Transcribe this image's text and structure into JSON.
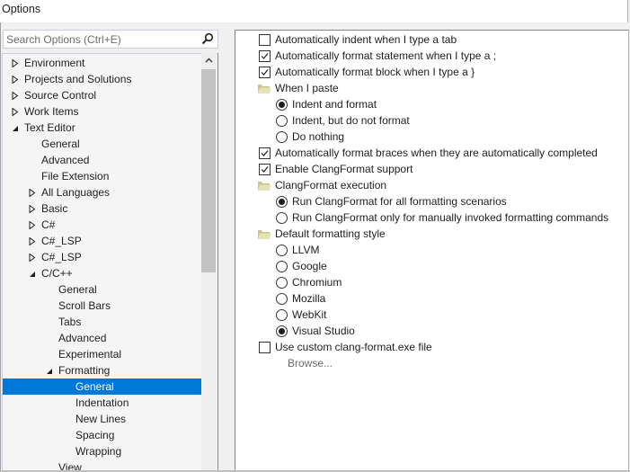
{
  "window": {
    "title": "Options"
  },
  "search": {
    "placeholder": "Search Options (Ctrl+E)",
    "value": ""
  },
  "tree": {
    "items": [
      {
        "label": "Environment",
        "level": 0,
        "expander": "collapsed"
      },
      {
        "label": "Projects and Solutions",
        "level": 0,
        "expander": "collapsed"
      },
      {
        "label": "Source Control",
        "level": 0,
        "expander": "collapsed"
      },
      {
        "label": "Work Items",
        "level": 0,
        "expander": "collapsed"
      },
      {
        "label": "Text Editor",
        "level": 0,
        "expander": "expanded"
      },
      {
        "label": "General",
        "level": 1,
        "expander": "none"
      },
      {
        "label": "Advanced",
        "level": 1,
        "expander": "none"
      },
      {
        "label": "File Extension",
        "level": 1,
        "expander": "none"
      },
      {
        "label": "All Languages",
        "level": 1,
        "expander": "collapsed"
      },
      {
        "label": "Basic",
        "level": 1,
        "expander": "collapsed"
      },
      {
        "label": "C#",
        "level": 1,
        "expander": "collapsed"
      },
      {
        "label": "C#_LSP",
        "level": 1,
        "expander": "collapsed"
      },
      {
        "label": "C#_LSP",
        "level": 1,
        "expander": "collapsed"
      },
      {
        "label": "C/C++",
        "level": 1,
        "expander": "expanded"
      },
      {
        "label": "General",
        "level": 2,
        "expander": "none"
      },
      {
        "label": "Scroll Bars",
        "level": 2,
        "expander": "none"
      },
      {
        "label": "Tabs",
        "level": 2,
        "expander": "none"
      },
      {
        "label": "Advanced",
        "level": 2,
        "expander": "none"
      },
      {
        "label": "Experimental",
        "level": 2,
        "expander": "none"
      },
      {
        "label": "Formatting",
        "level": 2,
        "expander": "expanded"
      },
      {
        "label": "General",
        "level": 3,
        "expander": "none",
        "selected": true
      },
      {
        "label": "Indentation",
        "level": 3,
        "expander": "none"
      },
      {
        "label": "New Lines",
        "level": 3,
        "expander": "none"
      },
      {
        "label": "Spacing",
        "level": 3,
        "expander": "none"
      },
      {
        "label": "Wrapping",
        "level": 3,
        "expander": "none"
      },
      {
        "label": "View",
        "level": 2,
        "expander": "none"
      }
    ]
  },
  "options": [
    {
      "type": "checkbox",
      "label": "Automatically indent when I type a tab",
      "checked": false,
      "indent": 0
    },
    {
      "type": "checkbox",
      "label": "Automatically format statement when I type a ;",
      "checked": true,
      "indent": 0
    },
    {
      "type": "checkbox",
      "label": "Automatically format block when I type a }",
      "checked": true,
      "indent": 0
    },
    {
      "type": "group",
      "label": "When I paste",
      "indent": 0
    },
    {
      "type": "radio",
      "label": "Indent and format",
      "checked": true,
      "indent": 1
    },
    {
      "type": "radio",
      "label": "Indent, but do not format",
      "checked": false,
      "indent": 1
    },
    {
      "type": "radio",
      "label": "Do nothing",
      "checked": false,
      "indent": 1
    },
    {
      "type": "checkbox",
      "label": "Automatically format braces when they are automatically completed",
      "checked": true,
      "indent": 0
    },
    {
      "type": "checkbox",
      "label": "Enable ClangFormat support",
      "checked": true,
      "indent": 0
    },
    {
      "type": "group",
      "label": "ClangFormat execution",
      "indent": 0
    },
    {
      "type": "radio",
      "label": "Run ClangFormat for all formatting scenarios",
      "checked": true,
      "indent": 1
    },
    {
      "type": "radio",
      "label": "Run ClangFormat only for manually invoked formatting commands",
      "checked": false,
      "indent": 1
    },
    {
      "type": "group",
      "label": "Default formatting style",
      "indent": 0
    },
    {
      "type": "radio",
      "label": "LLVM",
      "checked": false,
      "indent": 1
    },
    {
      "type": "radio",
      "label": "Google",
      "checked": false,
      "indent": 1
    },
    {
      "type": "radio",
      "label": "Chromium",
      "checked": false,
      "indent": 1
    },
    {
      "type": "radio",
      "label": "Mozilla",
      "checked": false,
      "indent": 1
    },
    {
      "type": "radio",
      "label": "WebKit",
      "checked": false,
      "indent": 1
    },
    {
      "type": "radio",
      "label": "Visual Studio",
      "checked": true,
      "indent": 1
    },
    {
      "type": "checkbox",
      "label": "Use custom clang-format.exe file",
      "checked": false,
      "indent": 0
    },
    {
      "type": "link",
      "label": "Browse...",
      "indent": 2,
      "disabled": true
    }
  ],
  "colors": {
    "selection": "#0078d7",
    "folder": "#d9d4a0"
  }
}
